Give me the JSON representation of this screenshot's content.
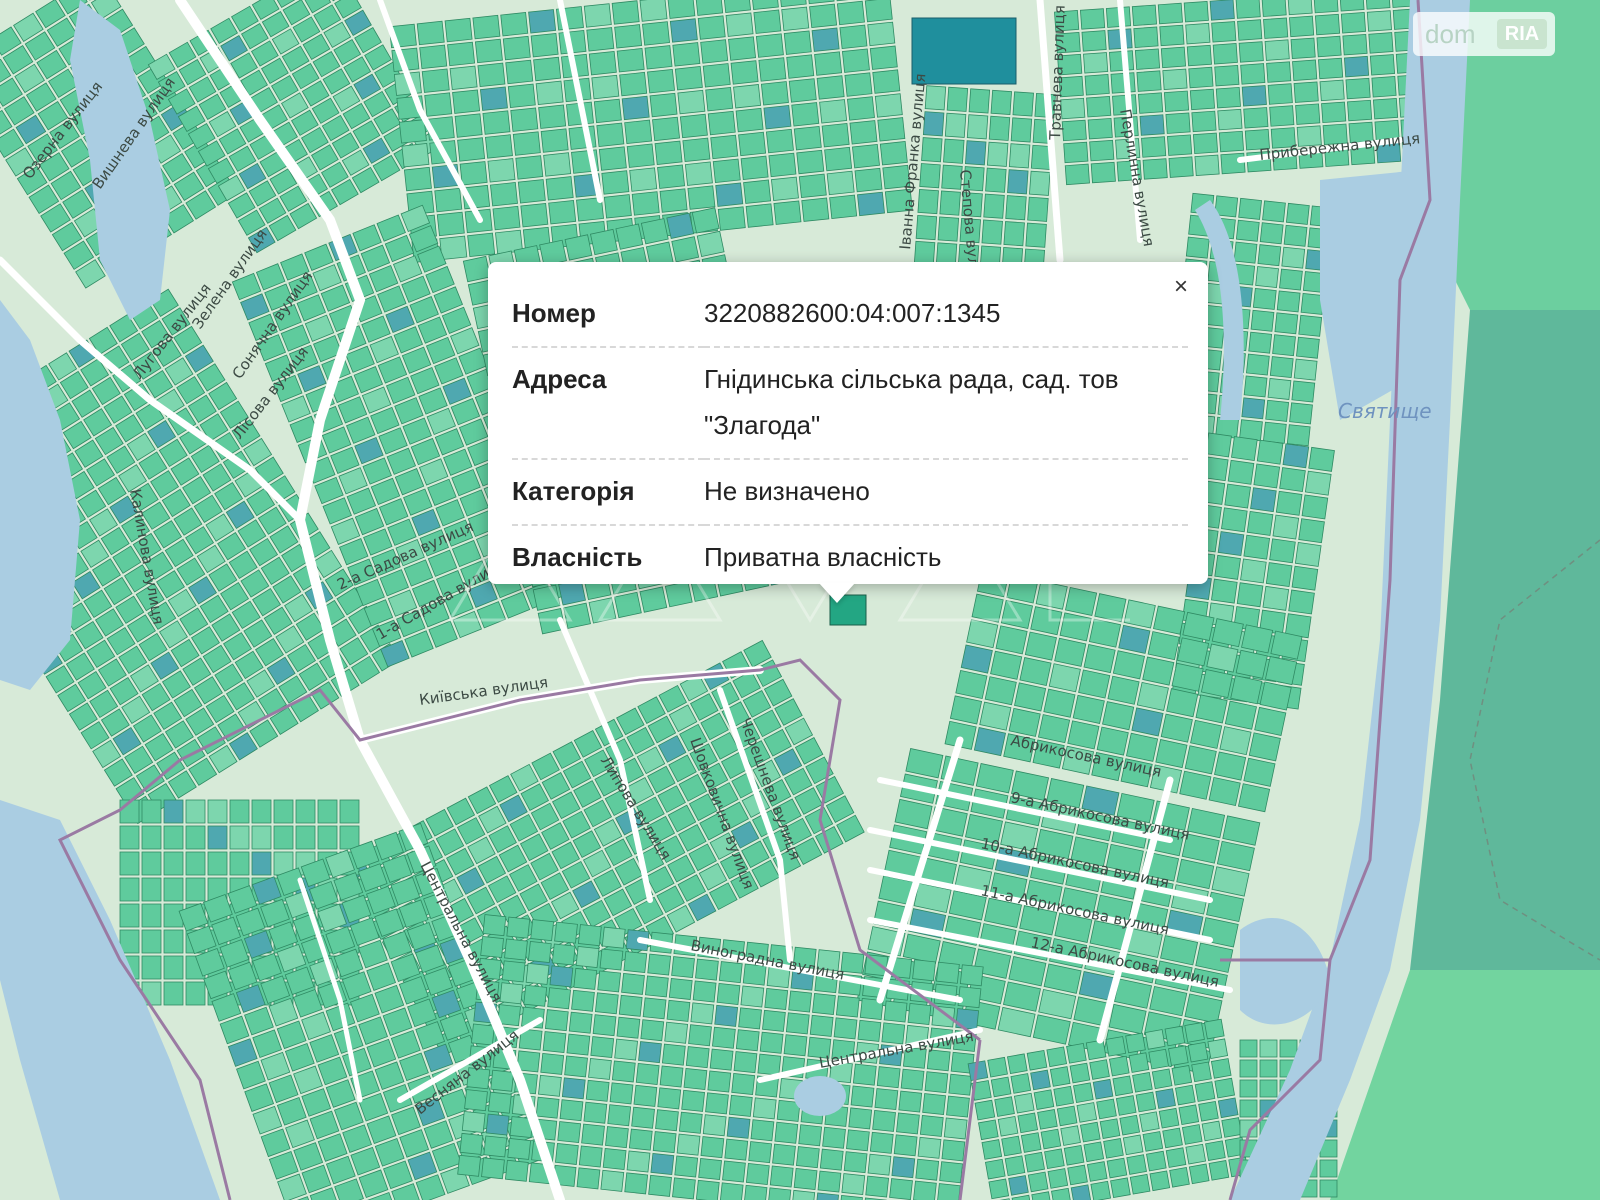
{
  "map": {
    "colors": {
      "background": "#d7ead8",
      "parcel": "#5fcb9d",
      "parcel_border": "#2f8a63",
      "water": "#aacde2",
      "road": "#ffffff",
      "boundary": "#9a7aa3",
      "highlight": "#1f8f9d"
    },
    "water_label": "Святище",
    "streets": [
      "Центральна вулиця",
      "Центральна вулиця",
      "Виноградна вулиця",
      "Весняна вулиця",
      "9-а Абрикосова вулиця",
      "10-а Абрикосова вулиця",
      "11-а Абрикосова вулиця",
      "12-а Абрикосова вулиця",
      "Абрикосова вулиця",
      "Черешнева вулиця",
      "Шовковична вулиця",
      "Липова вулиця",
      "1-а Садова вулиця",
      "2-а Садова вулиця",
      "Київська вулиця",
      "Лугова вулиця",
      "Озерна вулиця",
      "Вишнева вулиця",
      "Зелена вулиця",
      "Лісова вулиця",
      "Іванна Франка вулиця",
      "Степова вулиця",
      "Травнева вулиця",
      "Перлинна вулиця",
      "Прибережна вулиця",
      "Калинова вулиця",
      "Сонячна вулиця"
    ]
  },
  "popup": {
    "close": "×",
    "rows": [
      {
        "key": "Номер",
        "value": "3220882600:04:007:1345"
      },
      {
        "key": "Адреса",
        "value": "Гнідинська сільська рада, сад. тов \"Злагода\""
      },
      {
        "key": "Категорія",
        "value": "Не визначено"
      },
      {
        "key": "Власність",
        "value": "Приватна власність"
      }
    ]
  },
  "logo": {
    "dom": "dom",
    "ria": "RIA"
  }
}
